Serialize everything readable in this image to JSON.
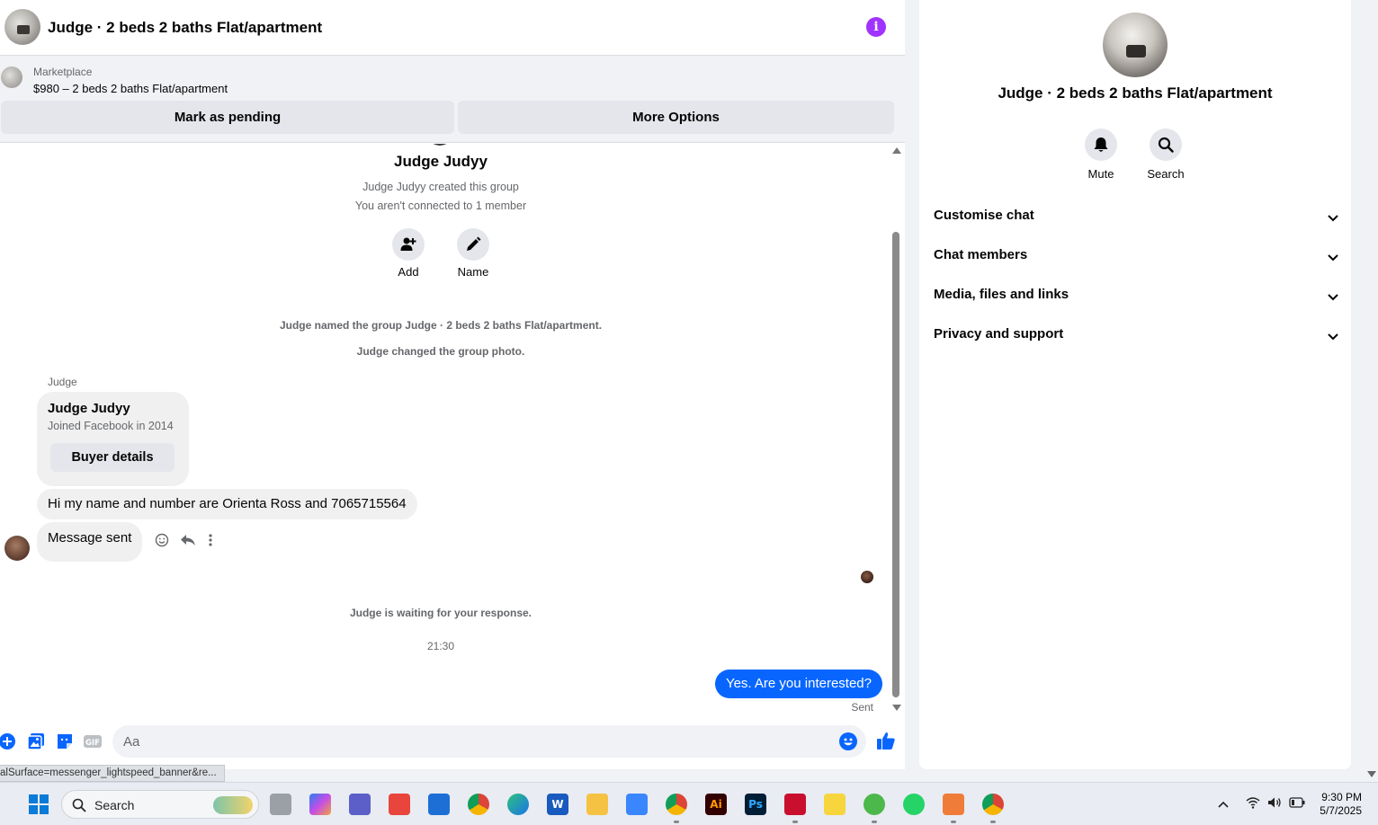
{
  "header": {
    "title": "Judge · 2 beds 2 baths Flat/apartment",
    "info_icon": "i"
  },
  "marketplace": {
    "label": "Marketplace",
    "listing": "$980 – 2 beds 2 baths Flat/apartment",
    "mark_pending": "Mark as pending",
    "more_options": "More Options"
  },
  "thread": {
    "group_name": "Judge Judyy",
    "created": "Judge Judyy created this group",
    "not_connected": "You aren't connected to 1 member",
    "add_label": "Add",
    "name_label": "Name",
    "sys_named": "Judge named the group Judge · 2 beds 2 baths Flat/apartment.",
    "sys_photo": "Judge changed the group photo.",
    "sender": "Judge",
    "card": {
      "name": "Judge Judyy",
      "joined": "Joined Facebook in 2014",
      "button": "Buyer details"
    },
    "msg1": "Hi my name and number are Orienta Ross and 7065715564",
    "msg2": "Message sent",
    "waiting": "Judge is waiting for your response.",
    "time": "21:30",
    "reply": "Yes. Are you interested?",
    "sent": "Sent"
  },
  "composer": {
    "placeholder": "Aa",
    "gif": "GIF"
  },
  "status_url": "alSurface=messenger_lightspeed_banner&re...",
  "info_panel": {
    "title": "Judge · 2 beds 2 baths Flat/apartment",
    "mute": "Mute",
    "search": "Search",
    "sections": [
      "Customise chat",
      "Chat members",
      "Media, files and links",
      "Privacy and support"
    ]
  },
  "taskbar": {
    "search": "Search",
    "ai_label": "Ai",
    "ps_label": "Ps",
    "word_label": "W",
    "time": "9:30 PM",
    "date": "5/7/2025"
  },
  "colors": {
    "accent": "#0866ff",
    "info": "#a033ff"
  }
}
